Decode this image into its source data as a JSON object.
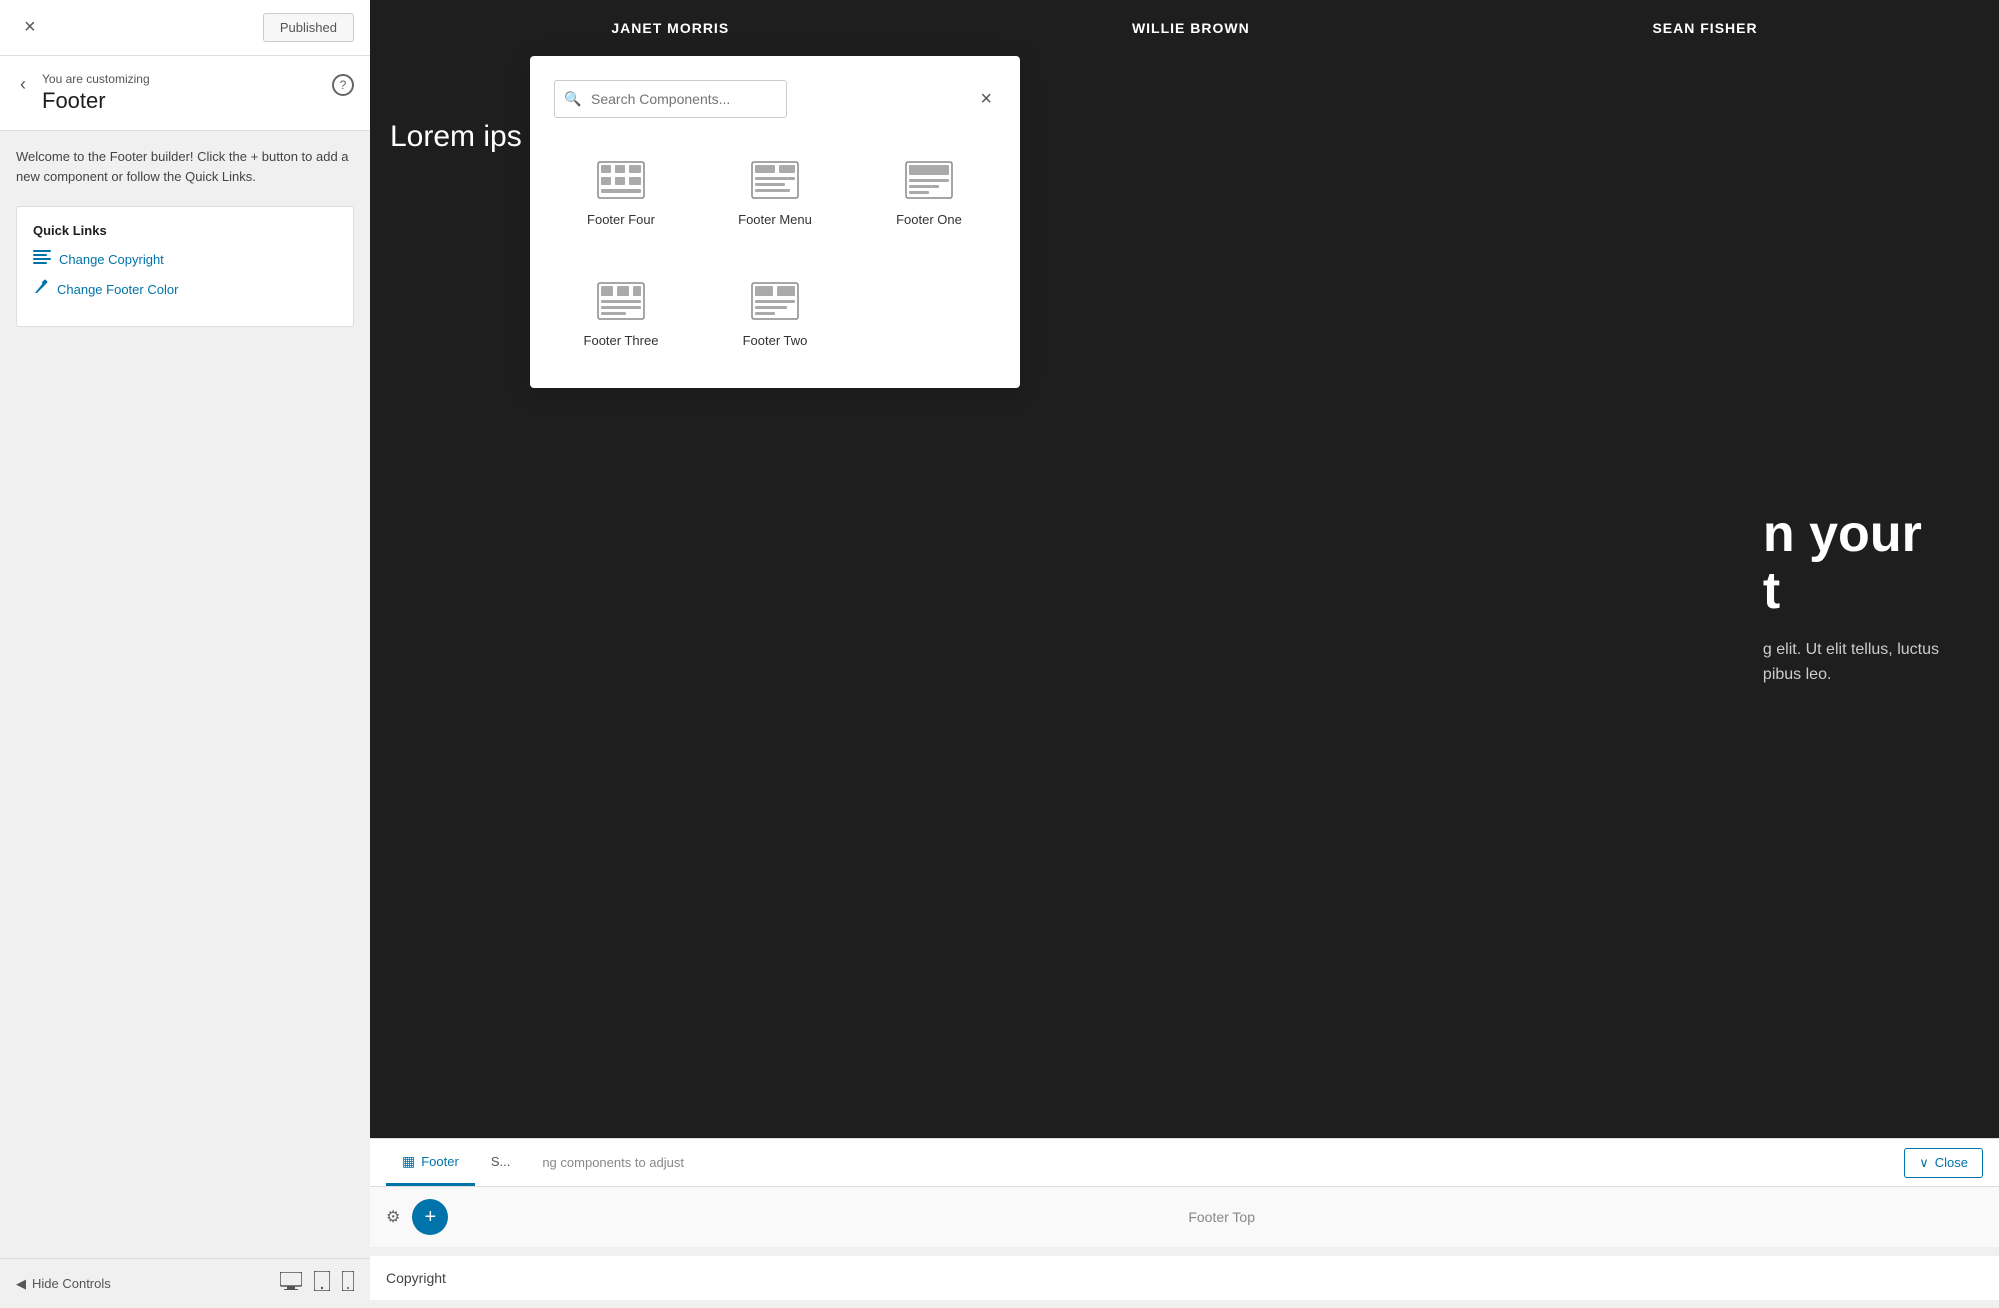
{
  "sidebar": {
    "close_label": "×",
    "published_label": "Published",
    "back_label": "‹",
    "customizing_label": "You are customizing",
    "customizing_title": "Footer",
    "help_label": "?",
    "welcome_text": "Welcome to the Footer builder! Click the + button to add a new component or follow the Quick Links.",
    "quick_links": {
      "title": "Quick Links",
      "items": [
        {
          "label": "Change Copyright",
          "icon": "table-icon"
        },
        {
          "label": "Change Footer Color",
          "icon": "brush-icon"
        }
      ]
    },
    "hide_controls_label": "Hide Controls",
    "devices": [
      "desktop",
      "tablet",
      "mobile"
    ]
  },
  "header": {
    "name1": "JANET MORRIS",
    "name2": "WILLIE BROWN",
    "name3": "SEAN FISHER"
  },
  "hero": {
    "title_line1": "n your",
    "title_line2": "t",
    "lorem_start": "Lorem ips",
    "body_text1": "g elit. Ut elit tellus, luctus",
    "body_text2": "pibus leo."
  },
  "footer_bar": {
    "tab_footer_label": "Footer",
    "tab_next_label": "S...",
    "close_btn_label": "Close",
    "hint_text": "ng components to adjust",
    "footer_top_label": "Footer Top",
    "copyright_label": "Copyright"
  },
  "modal": {
    "search_placeholder": "Search Components...",
    "close_label": "×",
    "components": [
      {
        "label": "Footer Four",
        "icon": "grid"
      },
      {
        "label": "Footer Menu",
        "icon": "grid"
      },
      {
        "label": "Footer One",
        "icon": "grid"
      },
      {
        "label": "Footer Three",
        "icon": "grid"
      },
      {
        "label": "Footer Two",
        "icon": "grid"
      }
    ]
  },
  "colors": {
    "accent": "#0073aa",
    "dark_bg": "#1e1e1e"
  }
}
